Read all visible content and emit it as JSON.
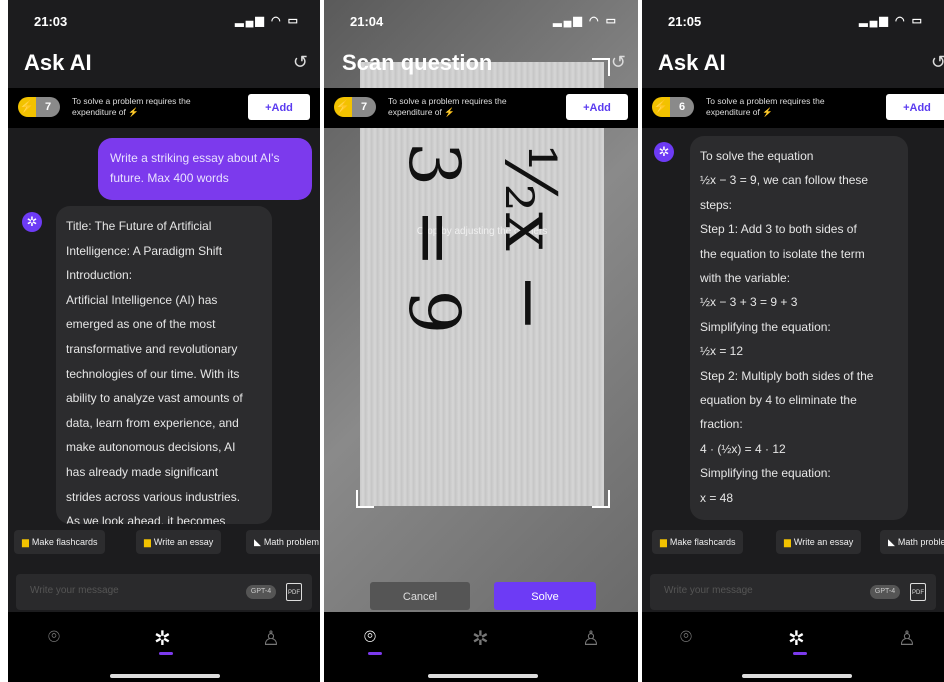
{
  "screens": [
    {
      "time": "21:03",
      "title": "Ask AI",
      "credits": "7",
      "banner_text": "To solve a problem requires the expenditure of ⚡",
      "add_label": "+Add",
      "user_message": "Write a striking essay about AI's future. Max 400 words",
      "ai_lines": [
        "Title: The Future of Artificial",
        "Intelligence: A Paradigm Shift",
        "Introduction:",
        "Artificial Intelligence (AI) has",
        "emerged as one of the most",
        "transformative and revolutionary",
        "technologies of our time. With its",
        "ability to analyze vast amounts of",
        "data, learn from experience, and",
        "make autonomous decisions, AI",
        "has already made significant",
        "strides across various industries.",
        "As we look ahead, it becomes"
      ],
      "chips": [
        "Make flashcards",
        "Write an essay",
        "Math problem"
      ],
      "input_placeholder": "Write your message",
      "model_badge": "GPT-4",
      "pdf_label": "PDF"
    },
    {
      "time": "21:04",
      "title": "Scan question",
      "credits": "7",
      "banner_text": "To solve a problem requires the expenditure of ⚡",
      "add_label": "+Add",
      "crop_hint": "Crop by adjusting the corners",
      "equation": "½x − 3 = 9",
      "cancel_label": "Cancel",
      "solve_label": "Solve"
    },
    {
      "time": "21:05",
      "title": "Ask AI",
      "credits": "6",
      "banner_text": "To solve a problem requires the expenditure of ⚡",
      "add_label": "+Add",
      "ai_lines": [
        "To solve the equation",
        "½x − 3 = 9, we can follow these",
        "steps:",
        "Step 1: Add 3 to both sides of",
        "the equation to isolate the term",
        "with the variable:",
        "½x − 3 + 3 = 9 + 3",
        "Simplifying the equation:",
        "½x = 12",
        "Step 2: Multiply both sides of the",
        "equation by 4 to eliminate the",
        "fraction:",
        "4 · (½x) = 4 · 12",
        "Simplifying the equation:",
        "x = 48"
      ],
      "chips": [
        "Make flashcards",
        "Write an essay",
        "Math problem"
      ],
      "input_placeholder": "Write your message",
      "model_badge": "GPT-4",
      "pdf_label": "PDF"
    }
  ],
  "icons": {
    "status": "signal-wifi-battery",
    "history": "history-icon",
    "bolt": "bolt-icon",
    "tabs": [
      "camera-icon",
      "gear-icon",
      "user-icon"
    ]
  },
  "colors": {
    "accent": "#7c3aed",
    "bolt": "#f2c200",
    "background": "#1c1c1e"
  }
}
